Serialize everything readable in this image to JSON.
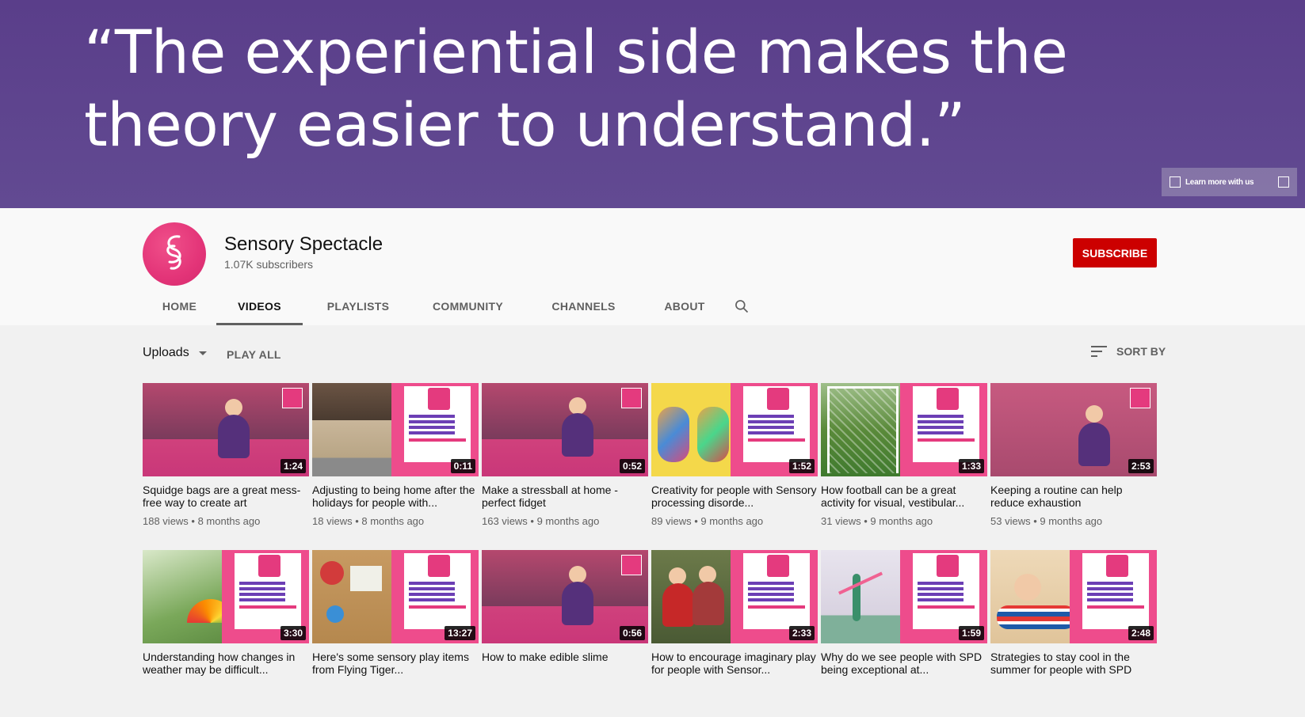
{
  "banner": {
    "quote": "“The experiential side makes the theory easier to understand.”",
    "link_label": "Learn more with us"
  },
  "channel": {
    "name": "Sensory Spectacle",
    "subscribers": "1.07K subscribers",
    "subscribe_label": "SUBSCRIBE",
    "avatar_text": "Sensory Spectacle"
  },
  "tabs": [
    {
      "label": "HOME",
      "active": false
    },
    {
      "label": "VIDEOS",
      "active": true
    },
    {
      "label": "PLAYLISTS",
      "active": false
    },
    {
      "label": "COMMUNITY",
      "active": false
    },
    {
      "label": "CHANNELS",
      "active": false
    },
    {
      "label": "ABOUT",
      "active": false
    }
  ],
  "toolbar": {
    "uploads_label": "Uploads",
    "play_all_label": "PLAY ALL",
    "sort_label": "SORT BY"
  },
  "videos_row1": [
    {
      "title": "Squidge bags are a great mess-free way to create art",
      "views": "188 views",
      "age": "8 months ago",
      "duration": "1:24"
    },
    {
      "title": "Adjusting to being home after the holidays for people with...",
      "views": "18 views",
      "age": "8 months ago",
      "duration": "0:11"
    },
    {
      "title": "Make a stressball at home - perfect fidget",
      "views": "163 views",
      "age": "9 months ago",
      "duration": "0:52"
    },
    {
      "title": "Creativity for people with Sensory processing disorde...",
      "views": "89 views",
      "age": "9 months ago",
      "duration": "1:52"
    },
    {
      "title": "How football can be a great activity for visual, vestibular...",
      "views": "31 views",
      "age": "9 months ago",
      "duration": "1:33"
    },
    {
      "title": "Keeping a routine can help reduce exhaustion",
      "views": "53 views",
      "age": "9 months ago",
      "duration": "2:53"
    }
  ],
  "videos_row2": [
    {
      "title": "Understanding how changes in weather may be difficult...",
      "duration": "3:30"
    },
    {
      "title": "Here's some sensory play items from Flying Tiger...",
      "duration": "13:27"
    },
    {
      "title": "How to make edible slime",
      "duration": "0:56"
    },
    {
      "title": "How to encourage imaginary play for people with Sensor...",
      "duration": "2:33"
    },
    {
      "title": "Why do we see people with SPD being exceptional at...",
      "duration": "1:59"
    },
    {
      "title": "Strategies to stay cool in the summer for people with SPD",
      "duration": "2:48"
    }
  ],
  "colors": {
    "banner": "#5a3e8a",
    "subscribe": "#cc0000",
    "brand_pink": "#ee4c8c"
  }
}
